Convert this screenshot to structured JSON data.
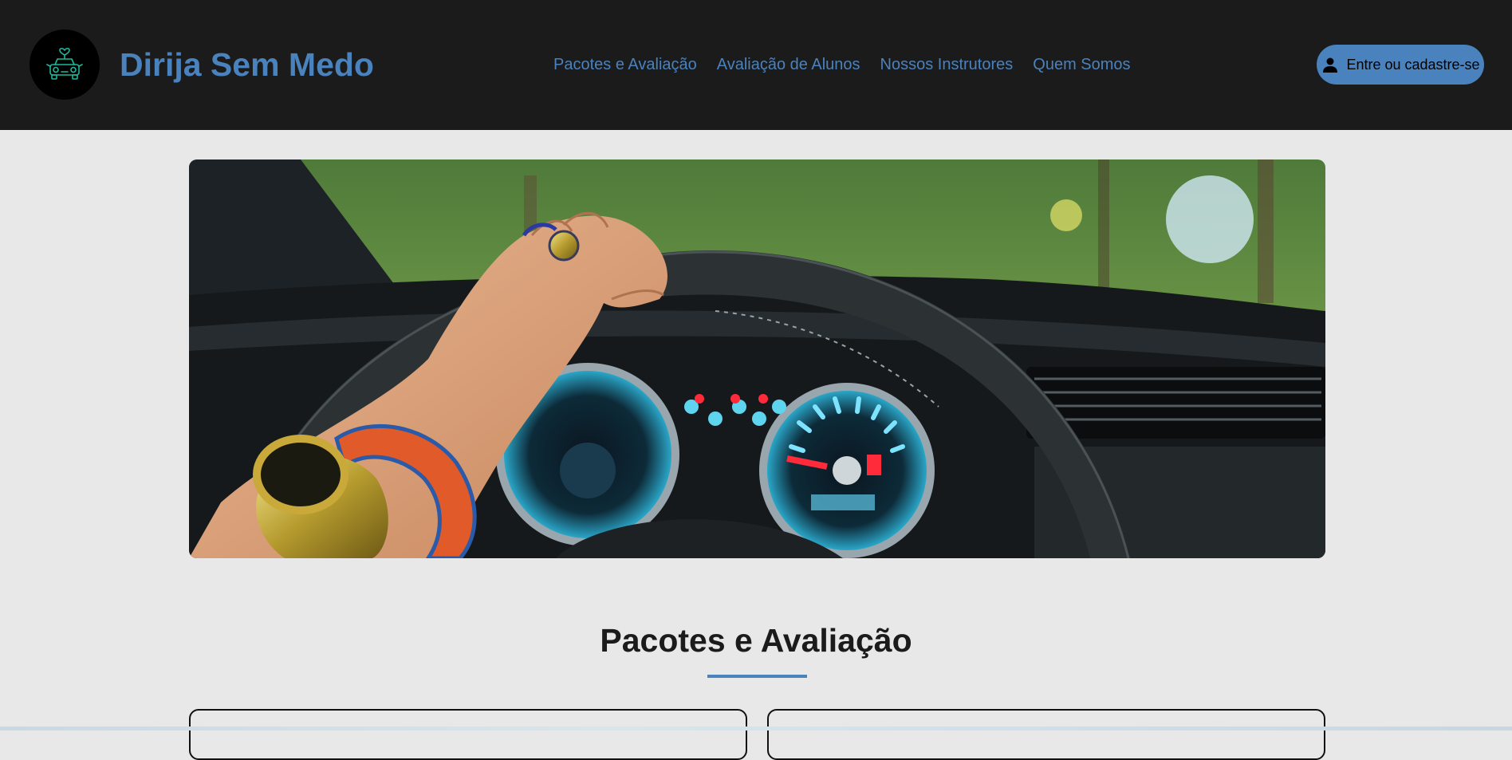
{
  "header": {
    "brand": "Dirija Sem Medo",
    "logo_icon": "car-heart-icon",
    "nav": [
      {
        "label": "Pacotes e Avaliação"
      },
      {
        "label": "Avaliação de Alunos"
      },
      {
        "label": "Nossos Instrutores"
      },
      {
        "label": "Quem Somos"
      }
    ],
    "login_label": "Entre ou cadastre-se",
    "login_icon": "user-icon"
  },
  "hero": {
    "image": "hand-on-steering-wheel-dashboard"
  },
  "section": {
    "title": "Pacotes e Avaliação"
  },
  "colors": {
    "header_bg": "#1b1b1b",
    "accent": "#4a82bd",
    "page_bg": "#e8e8e8",
    "logo_stroke": "#1fb89a"
  }
}
